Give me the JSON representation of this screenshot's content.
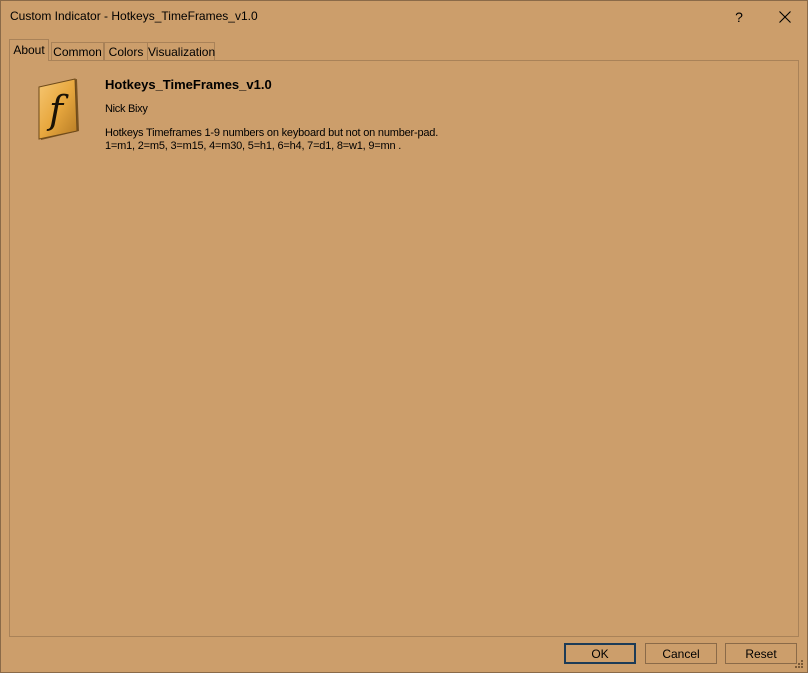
{
  "window": {
    "title": "Custom Indicator - Hotkeys_TimeFrames_v1.0",
    "help_label": "?",
    "close_icon": "close-icon"
  },
  "tabs": [
    {
      "label": "About",
      "active": true
    },
    {
      "label": "Common",
      "active": false
    },
    {
      "label": "Colors",
      "active": false
    },
    {
      "label": "Visualization",
      "active": false
    }
  ],
  "about": {
    "icon": "function-f-icon",
    "name": "Hotkeys_TimeFrames_v1.0",
    "author": "Nick Bixy",
    "description_line1": "Hotkeys Timeframes 1-9 numbers on keyboard but not on number-pad.",
    "description_line2": "1=m1, 2=m5, 3=m15, 4=m30, 5=h1, 6=h4, 7=d1, 8=w1, 9=mn ."
  },
  "buttons": {
    "ok": "OK",
    "cancel": "Cancel",
    "reset": "Reset"
  },
  "colors": {
    "background": "#cc9e6b",
    "default_button_border": "#1c3b57"
  }
}
